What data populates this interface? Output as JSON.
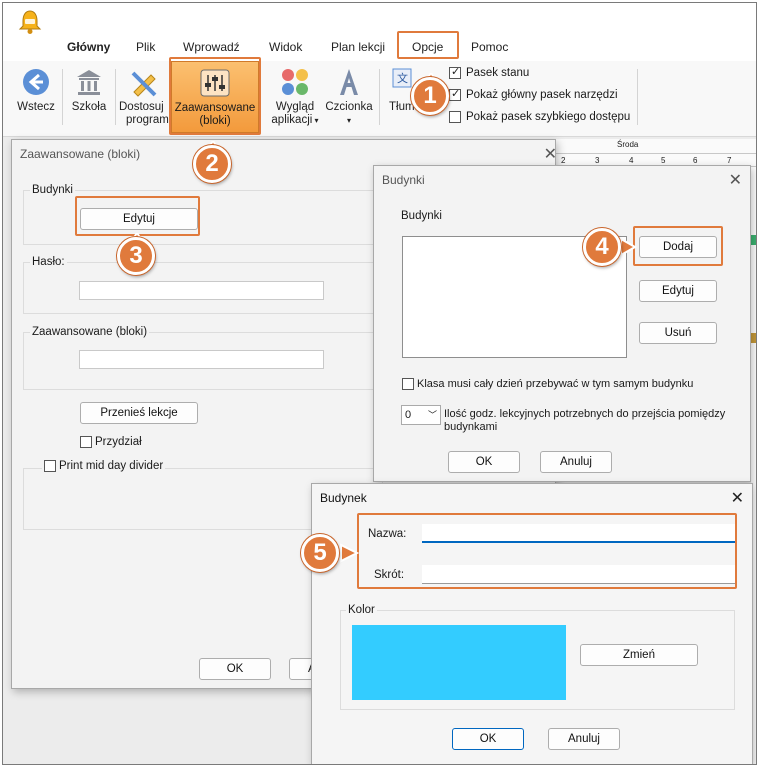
{
  "ribbon": {
    "tabs": [
      "Główny",
      "Plik",
      "Wprowadź",
      "Widok",
      "Plan lekcji",
      "Opcje",
      "Pomoc"
    ],
    "buttons": {
      "back": "Wstecz",
      "school": "Szkoła",
      "customize_1": "Dostosuj",
      "customize_2": "program",
      "advanced_1": "Zaawansowane",
      "advanced_2": "(bloki)",
      "look_1": "Wygląd",
      "look_2": "aplikacji",
      "font": "Czcionka",
      "translate": "Tłuma"
    },
    "checkboxes": [
      {
        "label": "Pasek stanu",
        "checked": true
      },
      {
        "label": "Pokaż główny pasek narzędzi",
        "checked": true
      },
      {
        "label": "Pokaż pasek szybkiego dostępu",
        "checked": false
      }
    ]
  },
  "grid": {
    "day": "Środa",
    "numbers": [
      "2",
      "3",
      "4",
      "5",
      "6",
      "7"
    ]
  },
  "dialog_advanced": {
    "title": "Zaawansowane (bloki)",
    "buildings_label": "Budynki",
    "edit_button": "Edytuj",
    "password_label": "Hasło:",
    "advanced_label": "Zaawansowane (bloki)",
    "move_lessons_button": "Przenieś lekcje",
    "assignment_checkbox": "Przydział",
    "print_divider_checkbox": "Print mid day divider",
    "ok_button": "OK",
    "cancel_button_partial": "A"
  },
  "dialog_buildings": {
    "title": "Budynki",
    "list_label": "Budynki",
    "add_button": "Dodaj",
    "edit_button": "Edytuj",
    "delete_button": "Usuń",
    "same_building_checkbox": "Klasa musi cały dzień przebywać w tym samym budynku",
    "hours_value": "0",
    "hours_label_1": "Ilość godz. lekcyjnych potrzebnych do przejścia pomiędzy",
    "hours_label_2": "budynkami",
    "ok_button": "OK",
    "cancel_button": "Anuluj"
  },
  "dialog_building": {
    "title": "Budynek",
    "name_label": "Nazwa:",
    "name_value": "",
    "short_label": "Skrót:",
    "short_value": "",
    "color_label": "Kolor",
    "color_value": "#33ccff",
    "change_button": "Zmień",
    "ok_button": "OK",
    "cancel_button": "Anuluj"
  },
  "callouts": [
    "1",
    "2",
    "3",
    "4",
    "5"
  ],
  "colors": {
    "accent": "#e07a3c",
    "highlight": "#f7a14d",
    "swatch": "#33ccff"
  }
}
